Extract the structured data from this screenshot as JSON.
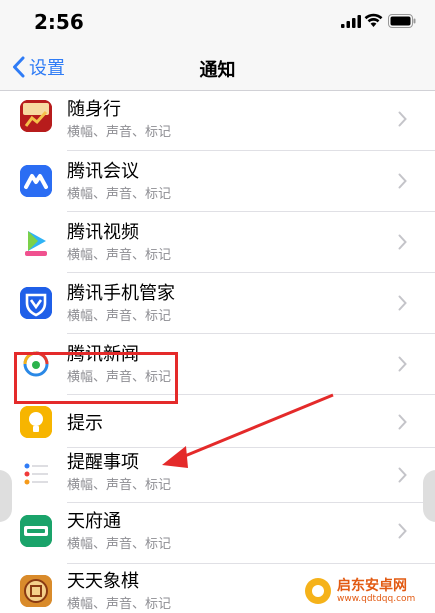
{
  "status_bar": {
    "time": "2:56"
  },
  "nav": {
    "back_label": "设置",
    "title": "通知"
  },
  "apps": [
    {
      "name": "随身行",
      "sub": "横幅、声音、标记",
      "icon": "suishenxing-icon"
    },
    {
      "name": "腾讯会议",
      "sub": "横幅、声音、标记",
      "icon": "tencent-meeting-icon"
    },
    {
      "name": "腾讯视频",
      "sub": "横幅、声音、标记",
      "icon": "tencent-video-icon"
    },
    {
      "name": "腾讯手机管家",
      "sub": "横幅、声音、标记",
      "icon": "tencent-phone-manager-icon"
    },
    {
      "name": "腾讯新闻",
      "sub": "横幅、声音、标记",
      "icon": "tencent-news-icon"
    },
    {
      "name": "提示",
      "sub": "",
      "icon": "tips-icon"
    },
    {
      "name": "提醒事项",
      "sub": "横幅、声音、标记",
      "icon": "reminders-icon"
    },
    {
      "name": "天府通",
      "sub": "横幅、声音、标记",
      "icon": "tianfutong-icon"
    },
    {
      "name": "天天象棋",
      "sub": "横幅、声音、标记",
      "icon": "tiantian-xiangqi-icon"
    }
  ],
  "annotation": {
    "highlighted_item": "提醒事项",
    "color": "#e42a2a"
  },
  "watermark": {
    "main": "启东安卓网",
    "url": "www.qdtdqq.com"
  },
  "colors": {
    "accent": "#2f7cf6",
    "secondary_text": "#8e8e93"
  }
}
